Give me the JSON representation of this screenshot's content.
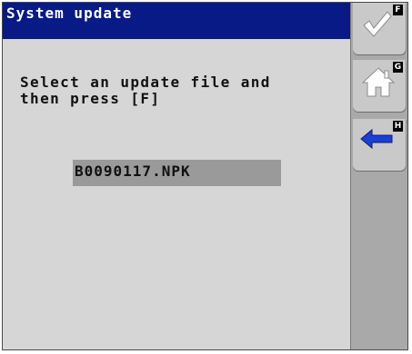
{
  "window": {
    "title": "System update"
  },
  "content": {
    "instruction": "Select an update file and\nthen press [F]",
    "files": [
      {
        "name": "B0090117.NPK",
        "selected": true
      }
    ]
  },
  "softkeys": [
    {
      "letter": "F",
      "icon": "checkmark-icon",
      "color": "#ffffff"
    },
    {
      "letter": "G",
      "icon": "home-icon",
      "color": "#ffffff"
    },
    {
      "letter": "H",
      "icon": "back-arrow-icon",
      "color": "#1a3fd6"
    }
  ],
  "colors": {
    "title_bar": "#081a86",
    "background": "#d6d6d6",
    "selection": "#9a9a9a",
    "softkey_panel": "#a9a9a9"
  }
}
